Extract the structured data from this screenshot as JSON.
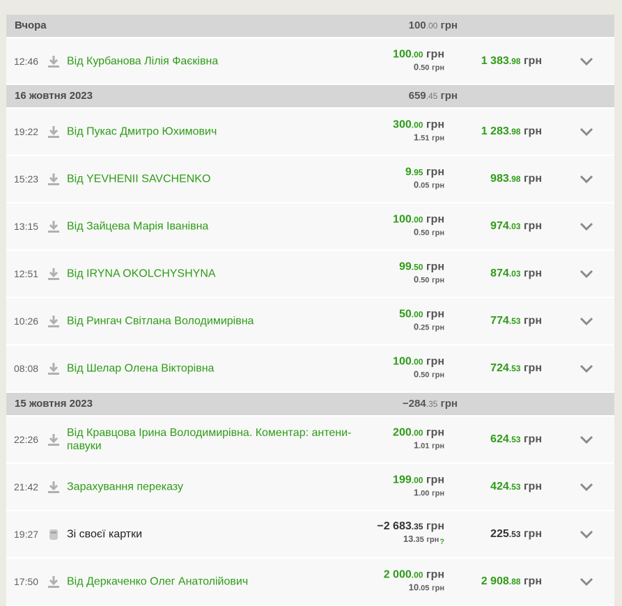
{
  "groups": [
    {
      "title": "Вчора",
      "total_int": "100",
      "total_dec": ".00",
      "currency": "грн",
      "rows": [
        {
          "time": "12:46",
          "icon": "download-icon",
          "desc": "Від Курбанова Лілія Фаєківна",
          "amt_int": "100",
          "amt_dec": ".00",
          "fee_int": "0",
          "fee_dec": ".50",
          "bal_int": "1 383",
          "bal_dec": ".98"
        }
      ]
    },
    {
      "title": "16 жовтня 2023",
      "total_int": "659",
      "total_dec": ".45",
      "currency": "грн",
      "rows": [
        {
          "time": "19:22",
          "icon": "download-icon",
          "desc": "Від Пукас Дмитро Юхимович",
          "amt_int": "300",
          "amt_dec": ".00",
          "fee_int": "1",
          "fee_dec": ".51",
          "bal_int": "1 283",
          "bal_dec": ".98"
        },
        {
          "time": "15:23",
          "icon": "download-icon",
          "desc": "Від YEVHENII SAVCHENKO",
          "amt_int": "9",
          "amt_dec": ".95",
          "fee_int": "0",
          "fee_dec": ".05",
          "bal_int": "983",
          "bal_dec": ".98"
        },
        {
          "time": "13:15",
          "icon": "download-icon",
          "desc": "Від Зайцева Марія Іванівна",
          "amt_int": "100",
          "amt_dec": ".00",
          "fee_int": "0",
          "fee_dec": ".50",
          "bal_int": "974",
          "bal_dec": ".03"
        },
        {
          "time": "12:51",
          "icon": "download-icon",
          "desc": "Від IRYNA OKOLCHYSHYNA",
          "amt_int": "99",
          "amt_dec": ".50",
          "fee_int": "0",
          "fee_dec": ".50",
          "bal_int": "874",
          "bal_dec": ".03"
        },
        {
          "time": "10:26",
          "icon": "download-icon",
          "desc": "Від Рингач Світлана Володимирівна",
          "amt_int": "50",
          "amt_dec": ".00",
          "fee_int": "0",
          "fee_dec": ".25",
          "bal_int": "774",
          "bal_dec": ".53"
        },
        {
          "time": "08:08",
          "icon": "download-icon",
          "desc": "Від Шелар Олена Вікторівна",
          "amt_int": "100",
          "amt_dec": ".00",
          "fee_int": "0",
          "fee_dec": ".50",
          "bal_int": "724",
          "bal_dec": ".53"
        }
      ]
    },
    {
      "title": "15 жовтня 2023",
      "total_int": "−284",
      "total_dec": ".35",
      "currency": "грн",
      "rows": [
        {
          "time": "22:26",
          "icon": "download-icon",
          "desc": "Від Кравцова Ірина Володимирівна. Коментар: антени-павуки",
          "amt_int": "200",
          "amt_dec": ".00",
          "fee_int": "1",
          "fee_dec": ".01",
          "bal_int": "624",
          "bal_dec": ".53"
        },
        {
          "time": "21:42",
          "icon": "download-icon",
          "desc": "Зарахування переказу",
          "amt_int": "199",
          "amt_dec": ".00",
          "fee_int": "1",
          "fee_dec": ".00",
          "bal_int": "424",
          "bal_dec": ".53"
        },
        {
          "time": "19:27",
          "icon": "card-icon",
          "desc": "Зі своєї картки",
          "amt_int": "−2 683",
          "amt_dec": ".35",
          "fee_int": "13",
          "fee_dec": ".35",
          "fee_help": "?",
          "bal_int": "225",
          "bal_dec": ".53"
        },
        {
          "time": "17:50",
          "icon": "download-icon",
          "desc": "Від Деркаченко Олег Анатолійович",
          "amt_int": "2 000",
          "amt_dec": ".00",
          "fee_int": "10",
          "fee_dec": ".05",
          "bal_int": "2 908",
          "bal_dec": ".88"
        }
      ]
    }
  ],
  "currency": "грн",
  "colors": {
    "positive": "#2e9c18",
    "neutral": "#333333",
    "header_bg": "#d6d6d6",
    "row_bg": "#f8f8f8"
  }
}
